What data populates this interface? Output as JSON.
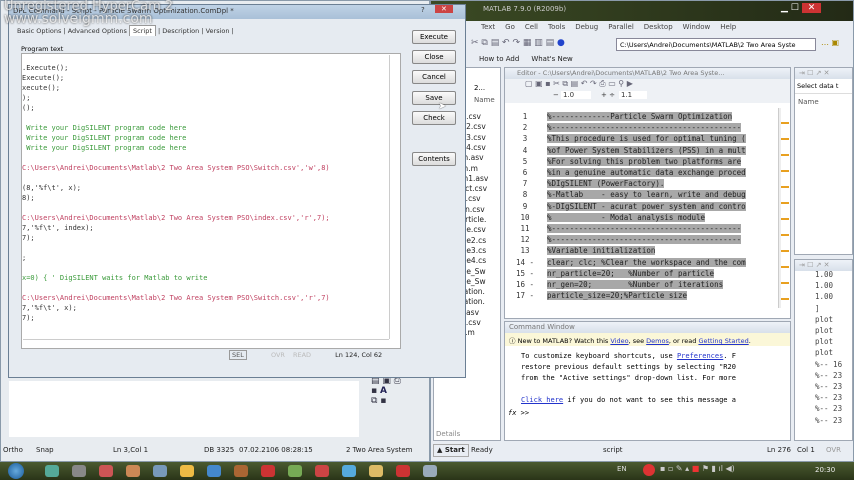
{
  "watermark": {
    "line1": "Unregistered HyperCam 2",
    "line2": "www.solveigmm.com"
  },
  "script_dialog": {
    "title": "DPL Command - Script - Particle Swarm Optimization.ComDpl *",
    "tabs": [
      "Basic Options",
      "Advanced Options",
      "Script",
      "Description",
      "Version"
    ],
    "program_text_label": "Program text",
    "code_lines": [
      {
        "t": ".Execute();",
        "c": "#333"
      },
      {
        "t": "Execute();",
        "c": "#333"
      },
      {
        "t": "xecute();",
        "c": "#333"
      },
      {
        "t": ");",
        "c": "#333"
      },
      {
        "t": "();",
        "c": "#333"
      },
      {
        "t": " Write your DigSILENT program code here",
        "c": "#3a9a3a"
      },
      {
        "t": " Write your DigSILENT program code here",
        "c": "#3a9a3a"
      },
      {
        "t": " Write your DigSILENT program code here",
        "c": "#3a9a3a"
      },
      {
        "t": "C:\\Users\\Andrei\\Documents\\Matlab\\2 Two Area System PSO\\Switch.csv','w',8)",
        "c": "#c04060"
      },
      {
        "t": "(8,'%f\\t', x);",
        "c": "#333"
      },
      {
        "t": "8);",
        "c": "#333"
      },
      {
        "t": "C:\\Users\\Andrei\\Documents\\Matlab\\2 Two Area System PSO\\index.csv','r',7);",
        "c": "#c04060"
      },
      {
        "t": "7,'%f\\t', index);",
        "c": "#333"
      },
      {
        "t": "7);",
        "c": "#333"
      },
      {
        "t": ";",
        "c": "#333"
      },
      {
        "t": "x=0) { ' DigSILENT waits for Matlab to write",
        "c": "#3a9a3a"
      },
      {
        "t": "C:\\Users\\Andrei\\Documents\\Matlab\\2 Two Area System PSO\\Switch.csv','r',7)",
        "c": "#c04060"
      },
      {
        "t": "7,'%f\\t', x);",
        "c": "#333"
      },
      {
        "t": "7);",
        "c": "#333"
      }
    ],
    "buttons": {
      "execute": "Execute",
      "close": "Close",
      "cancel": "Cancel",
      "save": "Save",
      "check": "Check",
      "contents": "Contents"
    },
    "status": {
      "sel": "SEL",
      "ovr": "OVR",
      "read": "READ",
      "position": "Ln 124, Col 62"
    }
  },
  "digsilent_status": {
    "ortho": "Ortho",
    "snap": "Snap",
    "position": "Ln 3,Col 1",
    "db": "DB 3325",
    "datetime": "07.02.2106 08:28:15",
    "project": "2 Two Area System"
  },
  "matlab": {
    "title": "MATLAB 7.9.0 (R2009b)",
    "menu": [
      "Text",
      "Go",
      "Cell",
      "Tools",
      "Debug",
      "Parallel",
      "Desktop",
      "Window",
      "Help"
    ],
    "current_folder": "C:\\Users\\Andrei\\Documents\\MATLAB\\2 Two Area Syste",
    "shortcuts": [
      "How to Add",
      "What's New"
    ],
    "folder_panel": {
      "dropdown": "2...",
      "column": "Name",
      "files": [
        "gen.csv",
        "gen2.csv",
        "gen3.csv",
        "gen4.csv",
        "tism.asv",
        "tism.m",
        "tism1.asv",
        "n_act.csv",
        "dex.csv",
        "_gen.csv",
        "_particle.",
        "rticle.csv",
        "rticle2.cs",
        "rticle3.cs",
        "rticle4.cs",
        "rticle_Sw",
        "rticle_Sw",
        "pulation.",
        "pulation.",
        "ect.asv",
        "itch.csv",
        "eze.m"
      ],
      "details": "Details"
    },
    "editor": {
      "title": "Editor - C:\\Users\\Andrei\\Documents\\MATLAB\\2 Two Area Syste...",
      "zoom_minus": "1.0",
      "zoom_plus": "1.1",
      "lines": [
        {
          "n": "1",
          "t": "%-------------Particle Swarm Optimization"
        },
        {
          "n": "2",
          "t": "%------------------------------------------"
        },
        {
          "n": "3",
          "t": "%This procedure is used for optimal tuning ("
        },
        {
          "n": "4",
          "t": "%of Power System Stabilizers (PSS) in a mult"
        },
        {
          "n": "5",
          "t": "%For solving this problem two platforms are"
        },
        {
          "n": "6",
          "t": "%in a genuine automatic data exchange proced"
        },
        {
          "n": "7",
          "t": "%DIgSILENT (PowerFactory)."
        },
        {
          "n": "8",
          "t": "%-Matlab    - easy to learn, write and debug"
        },
        {
          "n": "9",
          "t": "%-DIgSILENT - acurat power system and contro"
        },
        {
          "n": "10",
          "t": "%           - Modal analysis module"
        },
        {
          "n": "11",
          "t": "%------------------------------------------"
        },
        {
          "n": "12",
          "t": "%------------------------------------------"
        },
        {
          "n": "13",
          "t": "%Variable initialization"
        },
        {
          "n": "14 -",
          "t": "clear; clc; %Clear the workspace and the com"
        },
        {
          "n": "15 -",
          "t": "nr_particle=20;   %Number of particle"
        },
        {
          "n": "16 -",
          "t": "nr_gen=20;        %Number of iterations"
        },
        {
          "n": "17 -",
          "t": "particle_size=20;%Particle size"
        }
      ]
    },
    "workspace": {
      "select": "Select data t",
      "column": "Name"
    },
    "history": [
      "1.00",
      "1.00",
      "1.00",
      "]",
      "plot",
      "plot",
      "plot",
      "plot",
      "%-- 16",
      "%-- 23",
      "%-- 23",
      "%-- 23",
      "%-- 23",
      "%-- 23"
    ],
    "command_window": {
      "title": "Command Window",
      "banner_pre": "New to MATLAB? Watch this ",
      "video": "Video",
      "banner_mid": ", see ",
      "demos": "Demos",
      "banner_mid2": ", or read ",
      "getting_started": "Getting Started",
      "banner_end": ".",
      "line1_pre": "To customize keyboard shortcuts, use ",
      "preferences": "Preferences",
      "line1_post": ". F",
      "line2": "restore previous default settings by selecting \"R20",
      "line3": "from the \"Active settings\" drop-down list. For more",
      "click_here": "Click here",
      "line4_post": " if you do not want to see this message a",
      "prompt": ">>"
    },
    "status": {
      "start": "Start",
      "ready": "Ready",
      "mode": "script",
      "ln_label": "Ln",
      "ln": "276",
      "col_label": "Col",
      "col": "1",
      "ovr": "OVR"
    }
  },
  "taskbar": {
    "lang": "EN",
    "clock": "20:30"
  }
}
